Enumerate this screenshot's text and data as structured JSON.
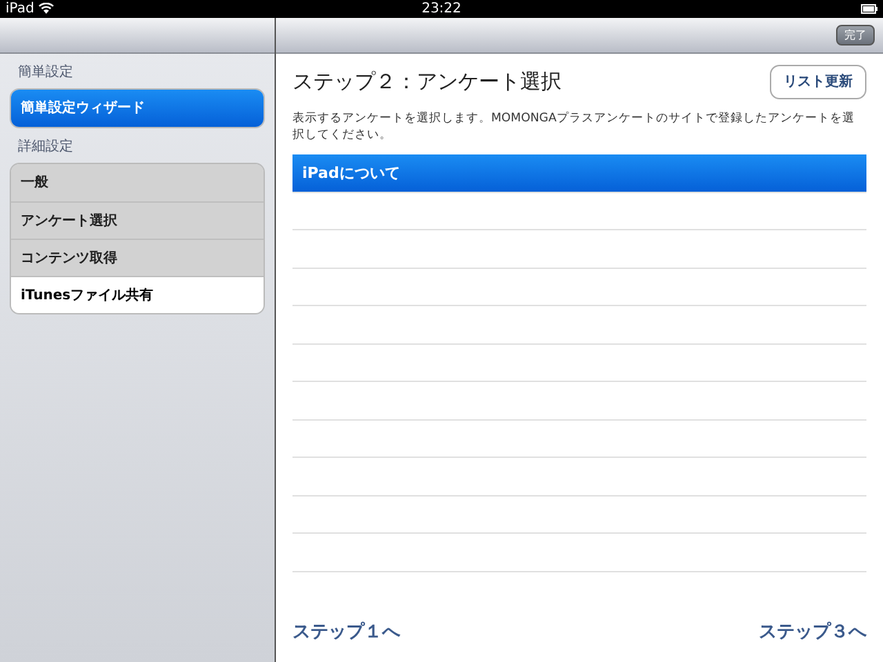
{
  "status_bar": {
    "carrier": "iPad",
    "time": "23:22"
  },
  "toolbar": {
    "done_button": "完了"
  },
  "sidebar": {
    "sections": [
      {
        "header": "簡単設定",
        "items": [
          {
            "label": "簡単設定ウィザード",
            "selected": true
          }
        ]
      },
      {
        "header": "詳細設定",
        "items": [
          {
            "label": "一般",
            "selected": false,
            "disabled": true
          },
          {
            "label": "アンケート選択",
            "selected": false,
            "disabled": true
          },
          {
            "label": "コンテンツ取得",
            "selected": false,
            "disabled": true
          },
          {
            "label": "iTunesファイル共有",
            "selected": false,
            "disabled": false
          }
        ]
      }
    ]
  },
  "content": {
    "title": "ステップ２：アンケート選択",
    "refresh_button": "リスト更新",
    "description": "表示するアンケートを選択します。MOMONGAプラスアンケートのサイトで登録したアンケートを選択してください。",
    "surveys": [
      {
        "label": "iPadについて",
        "selected": true
      }
    ],
    "prev_link": "ステップ１へ",
    "next_link": "ステップ３へ"
  }
}
